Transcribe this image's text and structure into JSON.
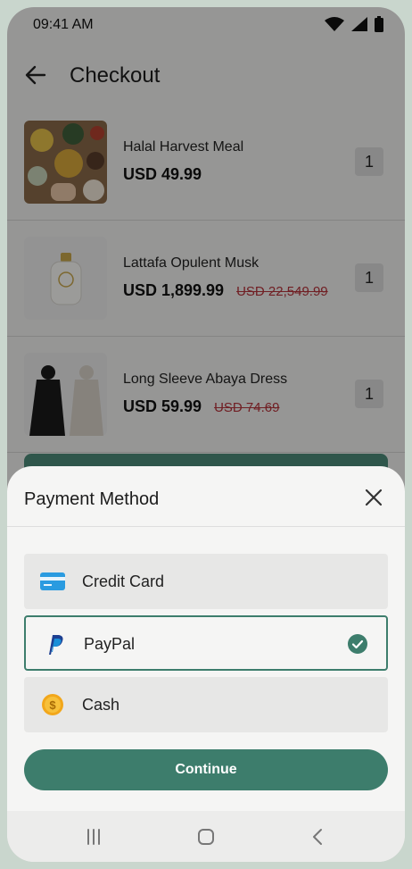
{
  "status": {
    "time": "09:41 AM",
    "icons": [
      "wifi-icon",
      "signal-icon",
      "battery-icon"
    ]
  },
  "header": {
    "title": "Checkout"
  },
  "cart_items": [
    {
      "name": "Halal Harvest Meal",
      "price": "USD 49.99",
      "old_price": "",
      "qty": "1"
    },
    {
      "name": "Lattafa Opulent Musk",
      "price": "USD 1,899.99",
      "old_price": "USD 22,549.99",
      "qty": "1"
    },
    {
      "name": " Long Sleeve Abaya Dress",
      "price": "USD 59.99",
      "old_price": "USD 74.69",
      "qty": "1"
    }
  ],
  "sheet": {
    "title": "Payment Method",
    "options": [
      {
        "label": "Credit Card",
        "icon": "credit-card-icon",
        "selected": false
      },
      {
        "label": "PayPal",
        "icon": "paypal-icon",
        "selected": true
      },
      {
        "label": "Cash",
        "icon": "cash-coin-icon",
        "selected": false
      }
    ],
    "continue_label": "Continue"
  },
  "colors": {
    "accent": "#3d7d6c",
    "strike_price": "#b5323a",
    "background": "#f3f3f1"
  }
}
